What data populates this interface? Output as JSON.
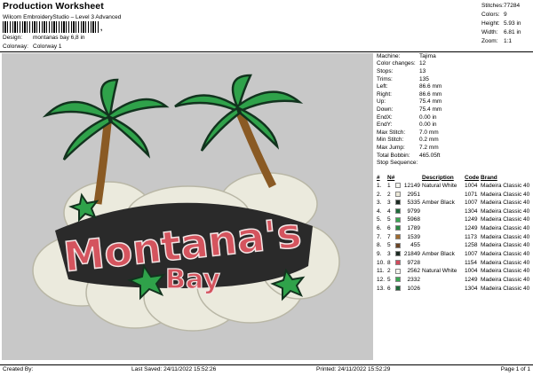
{
  "header": {
    "title": "Production Worksheet",
    "subtitle": "Wilcom EmbroideryStudio – Level 3 Advanced",
    "barcode_suffix": ","
  },
  "meta": [
    {
      "key": "Design:",
      "value": "montanas bay 6,8 in"
    },
    {
      "key": "Colorway:",
      "value": "Colorway 1"
    }
  ],
  "stats": [
    {
      "key": "Stitches:",
      "value": "77284"
    },
    {
      "key": "Colors:",
      "value": "9"
    },
    {
      "key": "Height:",
      "value": "5.93 in"
    },
    {
      "key": "Width:",
      "value": "6.81 in"
    },
    {
      "key": "Zoom:",
      "value": "1:1"
    }
  ],
  "machine_info": [
    {
      "key": "Machine:",
      "value": "Tajima"
    },
    {
      "key": "Color changes:",
      "value": "12"
    },
    {
      "key": "Stops:",
      "value": "13"
    },
    {
      "key": "Trims:",
      "value": "135"
    },
    {
      "key": "Left:",
      "value": "86.6 mm"
    },
    {
      "key": "Right:",
      "value": "86.6 mm"
    },
    {
      "key": "Up:",
      "value": "75.4 mm"
    },
    {
      "key": "Down:",
      "value": "75.4 mm"
    },
    {
      "key": "EndX:",
      "value": "0.00 in"
    },
    {
      "key": "EndY:",
      "value": "0.00 in"
    },
    {
      "key": "Max Stitch:",
      "value": "7.0 mm"
    },
    {
      "key": "Min Stitch:",
      "value": "0.2 mm"
    },
    {
      "key": "Max Jump:",
      "value": "7.2 mm"
    },
    {
      "key": "Total Bobbin:",
      "value": "465.05ft"
    },
    {
      "key": "Stop Sequence:",
      "value": ""
    }
  ],
  "stop_table": {
    "headers": [
      "#",
      "N#",
      "",
      "",
      "Description",
      "Code",
      "Brand"
    ],
    "rows": [
      {
        "stop": "1.",
        "n": "1",
        "color": "#f4f4ee",
        "num": "12149",
        "desc": "Natural White",
        "code": "1004",
        "brand": "Madeira Classic 40"
      },
      {
        "stop": "2.",
        "n": "2",
        "color": "#ece8d8",
        "num": "2951",
        "desc": "",
        "code": "1071",
        "brand": "Madeira Classic 40"
      },
      {
        "stop": "3.",
        "n": "3",
        "color": "#1c2a22",
        "num": "5335",
        "desc": "Amber Black",
        "code": "1007",
        "brand": "Madeira Classic 40"
      },
      {
        "stop": "4.",
        "n": "4",
        "color": "#1f6b3a",
        "num": "9799",
        "desc": "",
        "code": "1304",
        "brand": "Madeira Classic 40"
      },
      {
        "stop": "5.",
        "n": "5",
        "color": "#3aa852",
        "num": "5968",
        "desc": "",
        "code": "1249",
        "brand": "Madeira Classic 40"
      },
      {
        "stop": "6.",
        "n": "6",
        "color": "#2b8a44",
        "num": "1789",
        "desc": "",
        "code": "1249",
        "brand": "Madeira Classic 40"
      },
      {
        "stop": "7.",
        "n": "7",
        "color": "#a06a2e",
        "num": "1539",
        "desc": "",
        "code": "1173",
        "brand": "Madeira Classic 40"
      },
      {
        "stop": "8.",
        "n": "5",
        "color": "#6b4424",
        "num": "455",
        "desc": "",
        "code": "1258",
        "brand": "Madeira Classic 40"
      },
      {
        "stop": "9.",
        "n": "3",
        "color": "#1c2a22",
        "num": "21849",
        "desc": "Amber Black",
        "code": "1007",
        "brand": "Madeira Classic 40"
      },
      {
        "stop": "10.",
        "n": "8",
        "color": "#d24a5c",
        "num": "9728",
        "desc": "",
        "code": "1154",
        "brand": "Madeira Classic 40"
      },
      {
        "stop": "11.",
        "n": "2",
        "color": "#f4f4ee",
        "num": "2562",
        "desc": "Natural White",
        "code": "1004",
        "brand": "Madeira Classic 40"
      },
      {
        "stop": "12.",
        "n": "5",
        "color": "#3aa852",
        "num": "2332",
        "desc": "",
        "code": "1249",
        "brand": "Madeira Classic 40"
      },
      {
        "stop": "13.",
        "n": "6",
        "color": "#1f6b3a",
        "num": "1026",
        "desc": "",
        "code": "1304",
        "brand": "Madeira Classic 40"
      }
    ]
  },
  "design_art": {
    "line1": "Montana's",
    "line2": "Bay",
    "text_color": "#d4545e",
    "outline_color": "#2a2a2a",
    "cloud_color": "#ebeadd",
    "palm_color": "#2fa24a",
    "trunk_color": "#8a5a24"
  },
  "footer": {
    "created": "Created By:",
    "saved": "Last Saved: 24/11/2022 15:52:26",
    "printed": "Printed: 24/11/2022 15:52:29",
    "page": "Page 1 of 1"
  }
}
